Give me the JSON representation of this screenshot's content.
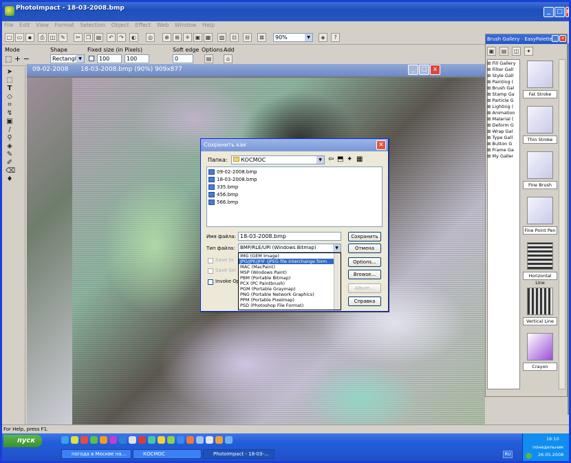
{
  "app": {
    "title": "PhotoImpact - 18-03-2008.bmp"
  },
  "menu": [
    "File",
    "Edit",
    "View",
    "Format",
    "Selection",
    "Object",
    "Effect",
    "Web",
    "Window",
    "Help"
  ],
  "toolbar": {
    "zoom": "90%"
  },
  "options": {
    "mode_label": "Mode",
    "shape_label": "Shape",
    "shape_value": "Rectangle",
    "fixed_label": "Fixed size (in Pixels)",
    "w": "100",
    "h": "100",
    "soft_label": "Soft edge",
    "soft_value": "0",
    "options_label": "Options",
    "add_label": "Add"
  },
  "image_window": {
    "tab1": "09-02-2008",
    "tab2": "18-03-2008.bmp (90%) 909x877"
  },
  "dialog": {
    "title": "Сохранить как",
    "folder_label": "Папка:",
    "folder": "КОСМОС",
    "files": [
      "09-02-2008.bmp",
      "18-03-2008.bmp",
      "335.bmp",
      "456.bmp",
      "566.bmp"
    ],
    "filename_label": "Имя файла:",
    "filename": "18-03-2008.bmp",
    "filetype_label": "Тип файла:",
    "filetype": "BMP/RLE/UPI (Windows Bitmap)",
    "save": "Сохранить",
    "cancel": "Отмена",
    "options": "Options...",
    "browse": "Browse...",
    "album": "Album...",
    "help": "Справка",
    "chk1": "Save to",
    "chk2": "Save Sel",
    "chk3": "Invoke Op",
    "types": [
      "IMG (GEM Image)",
      "JPG/JPE/JFIF (JPEG file interchange form",
      "MAC (MacPaint)",
      "MSP (Windows Paint)",
      "PBM (Portable Bitmap)",
      "PCX (PC Paintbrush)",
      "PGM (Portable Graymap)",
      "PNG (Portable Network Graphics)",
      "PPM (Portable Pixelmap)",
      "PSD (Photoshop File Format)"
    ]
  },
  "brush": {
    "title": "Brush Gallery - EasyPalette",
    "tree": [
      "Fill Gallery",
      "Filter Gall",
      "Style Gall",
      "Painting (",
      "Brush Gal",
      "Stamp Ga",
      "Particle G",
      "Lighting (",
      "Animation",
      "Material (",
      "Deform G",
      "Wrap Gal",
      "Type Gall",
      "Button G",
      "Frame Ga",
      "My Galler"
    ],
    "items": [
      "Fat Stroke",
      "Thin Stroke",
      "Fine Brush",
      "Fine Point Pen",
      "Horizontal Line",
      "Vertical Line",
      "Crayon"
    ]
  },
  "status": {
    "help": "For Help, press F1."
  },
  "taskbar": {
    "start": "пуск",
    "tasks": [
      "погода в Москве на...",
      "КОСМОС",
      "PhotoImpact - 18-03-..."
    ],
    "lang": "RU",
    "time": "16:10",
    "day": "понедельник",
    "date": "26.05.2008"
  }
}
